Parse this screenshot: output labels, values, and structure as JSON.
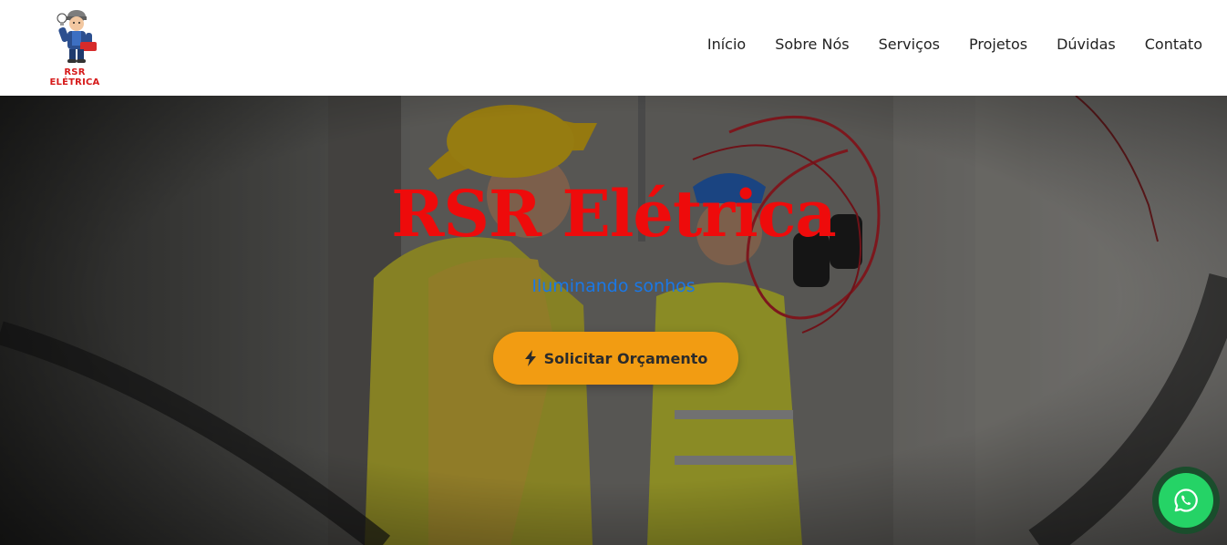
{
  "brand": {
    "logo_text": "RSR ELÉTRICA",
    "logo_text_color": "#d61a1a"
  },
  "nav": {
    "items": [
      "Início",
      "Sobre Nós",
      "Serviços",
      "Projetos",
      "Dúvidas",
      "Contato"
    ]
  },
  "hero": {
    "title": "RSR Elétrica",
    "subtitle": "Iluminando sonhos",
    "cta_label": "Solicitar Orçamento",
    "cta_icon": "bolt-icon",
    "title_color": "#ee0b0b",
    "subtitle_color": "#1a78e6",
    "cta_color": "#f29c12"
  },
  "floating": {
    "icon": "whatsapp-icon",
    "color": "#25d366"
  }
}
